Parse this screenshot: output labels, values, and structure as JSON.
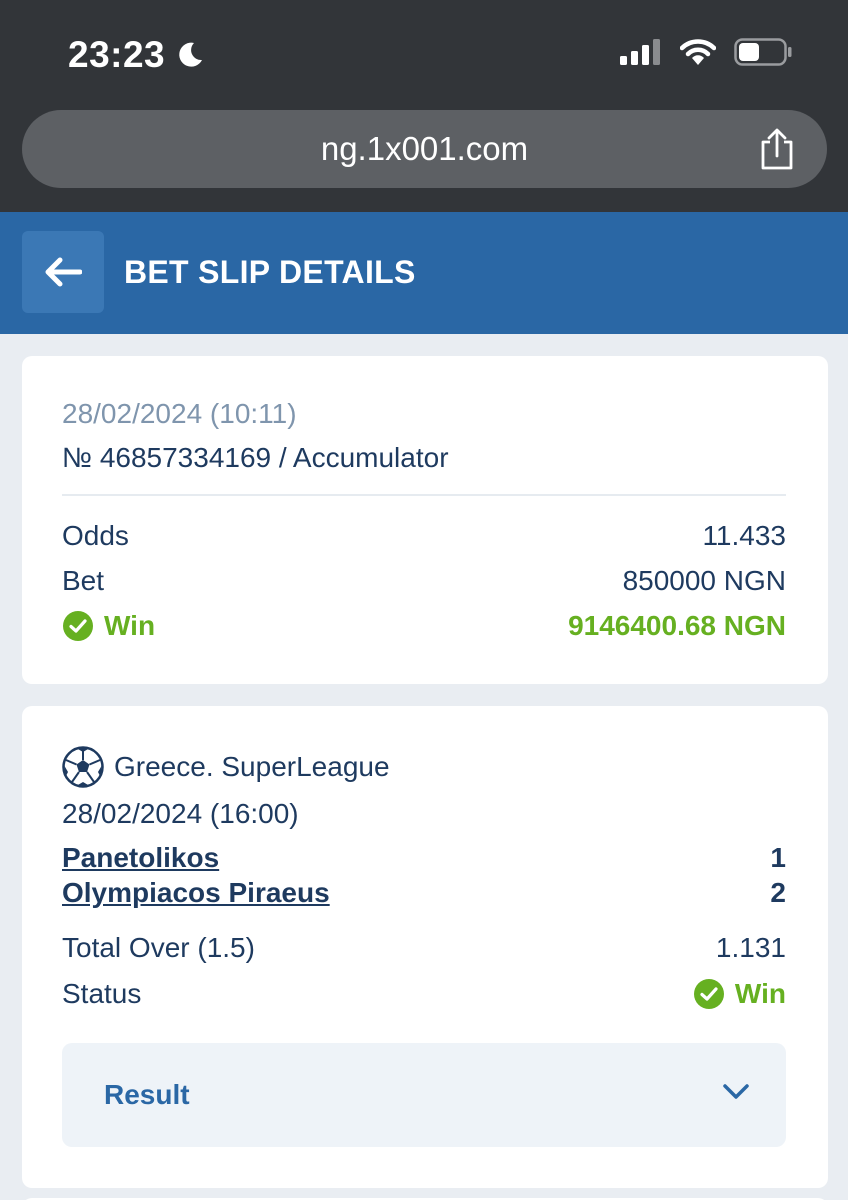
{
  "status_bar": {
    "time": "23:23"
  },
  "browser": {
    "url": "ng.1x001.com"
  },
  "header": {
    "title": "BET SLIP DETAILS"
  },
  "slip": {
    "datetime": "28/02/2024 (10:11)",
    "number_line": "№ 46857334169 / Accumulator",
    "odds_label": "Odds",
    "odds_value": "11.433",
    "bet_label": "Bet",
    "bet_value": "850000 NGN",
    "win_label": "Win",
    "win_value": "9146400.68 NGN"
  },
  "event": {
    "league": "Greece. SuperLeague",
    "datetime": "28/02/2024 (16:00)",
    "team1": "Panetolikos",
    "team1_score": "1",
    "team2": "Olympiacos Piraeus",
    "team2_score": "2",
    "market_label": "Total Over (1.5)",
    "market_odds": "1.131",
    "status_label": "Status",
    "status_value": "Win",
    "result_label": "Result"
  },
  "colors": {
    "header_bg": "#2a67a5",
    "win_green": "#66b021",
    "text_dark": "#1e3a5f",
    "text_muted": "#7f95ad"
  },
  "icons": [
    "moon-icon",
    "signal-icon",
    "wifi-icon",
    "battery-icon",
    "share-icon",
    "back-arrow-icon",
    "check-circle-icon",
    "soccer-ball-icon",
    "chevron-down-icon"
  ]
}
